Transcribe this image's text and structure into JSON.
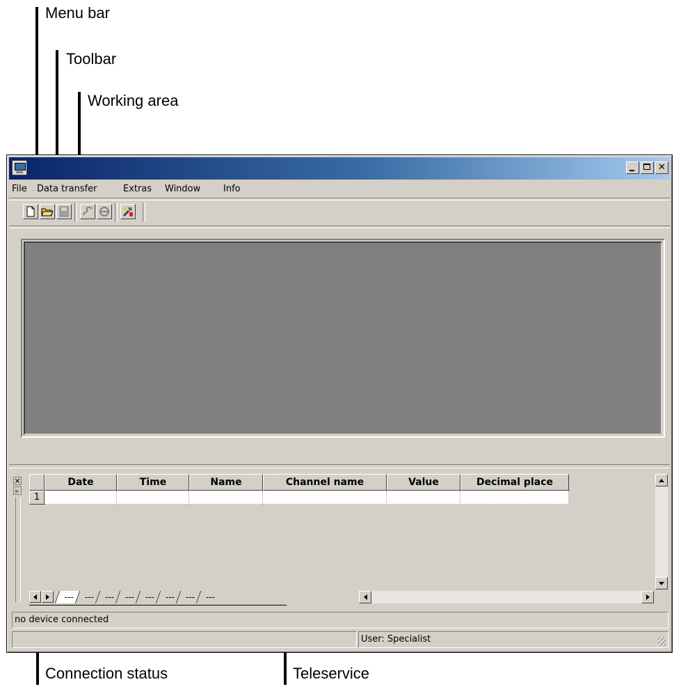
{
  "callouts": {
    "menu_bar": "Menu bar",
    "toolbar": "Toolbar",
    "working_area": "Working area",
    "connection_status": "Connection status",
    "teleservice": "Teleservice"
  },
  "window": {
    "caption_buttons": [
      "minimize-icon",
      "maximize-icon",
      "close-icon"
    ],
    "close_glyph": "✕"
  },
  "menu": {
    "items": [
      "File",
      "Data transfer",
      "Extras",
      "Window",
      "Info"
    ]
  },
  "toolbar": {
    "buttons": [
      {
        "icon": "new-document-icon",
        "enabled": true
      },
      {
        "icon": "open-folder-icon",
        "enabled": true
      },
      {
        "icon": "save-icon",
        "enabled": false
      },
      {
        "icon": "connect-icon",
        "enabled": false
      },
      {
        "icon": "disconnect-icon",
        "enabled": false
      },
      {
        "icon": "tools-icon",
        "enabled": true
      }
    ]
  },
  "teleservice": {
    "close_glyph": "✕",
    "pin_glyph": "▶",
    "columns": [
      "Date",
      "Time",
      "Name",
      "Channel name",
      "Value",
      "Decimal place"
    ],
    "rows": [
      {
        "num": "1",
        "cells": [
          "",
          "",
          "",
          "",
          "",
          ""
        ]
      }
    ],
    "tabs": [
      "---",
      "---",
      "---",
      "---",
      "---",
      "---",
      "---",
      "---"
    ]
  },
  "status": {
    "connection": "no device connected",
    "user": "User: Specialist"
  },
  "colors": {
    "title_gradient_start": "#0a246a",
    "title_gradient_end": "#a6caf0",
    "face": "#d4d0c8",
    "work_area": "#808080"
  }
}
